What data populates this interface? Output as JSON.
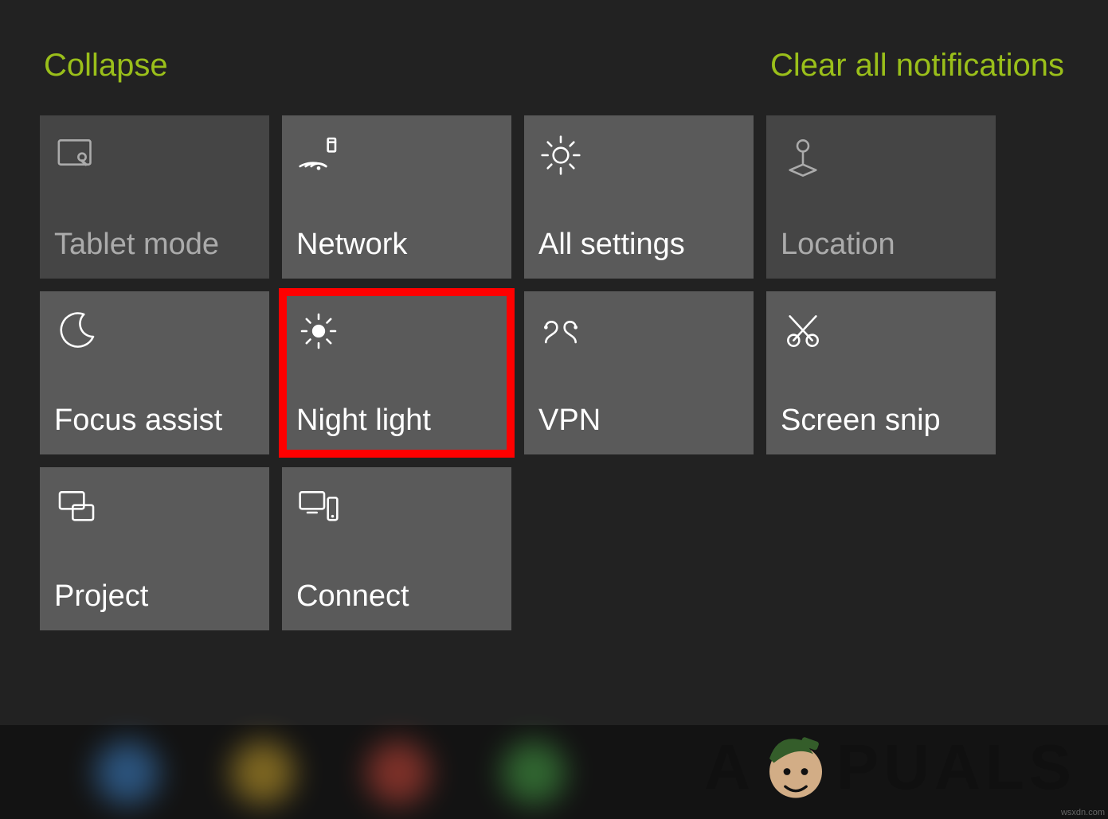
{
  "header": {
    "collapse": "Collapse",
    "clear": "Clear all notifications"
  },
  "tiles": {
    "tablet_mode": "Tablet mode",
    "network": "Network",
    "all_settings": "All settings",
    "location": "Location",
    "focus_assist": "Focus assist",
    "night_light": "Night light",
    "vpn": "VPN",
    "screen_snip": "Screen snip",
    "project": "Project",
    "connect": "Connect"
  },
  "colors": {
    "accent": "#9abf1a",
    "tile": "#5a5a5a",
    "tile_dim": "#454545",
    "highlight": "#ff0000",
    "background": "#222222"
  },
  "watermark": {
    "brand_left": "A",
    "brand_right": "PUALS",
    "attribution": "wsxdn.com"
  }
}
